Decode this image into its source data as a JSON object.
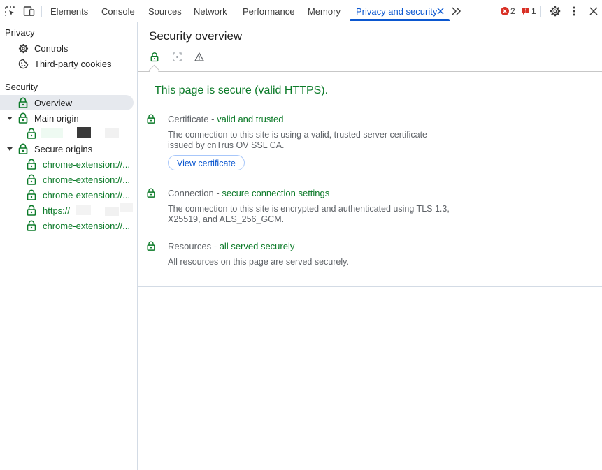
{
  "toolbar": {
    "tabs": [
      "Elements",
      "Console",
      "Sources",
      "Network",
      "Performance",
      "Memory",
      "Privacy and security"
    ],
    "active_tab": "Privacy and security",
    "error_count": "2",
    "issue_count": "1",
    "error_color": "#d93025",
    "issue_color": "#d93025",
    "accent_color": "#0b57d0",
    "icons": [
      "inspect-element-icon",
      "device-toolbar-icon",
      "close-tab-icon",
      "more-tabs-icon",
      "settings-gear-icon",
      "kebab-menu-icon",
      "close-devtools-icon"
    ]
  },
  "sidebar": {
    "privacy_heading": "Privacy",
    "privacy_items": [
      {
        "label": "Controls",
        "icon": "gear-icon"
      },
      {
        "label": "Third-party cookies",
        "icon": "cookie-icon"
      }
    ],
    "security_heading": "Security",
    "overview_label": "Overview",
    "main_origin_label": "Main origin",
    "secure_origins_label": "Secure origins",
    "secure_origin_items": [
      "chrome-extension://...",
      "chrome-extension://...",
      "chrome-extension://...",
      "https://",
      "chrome-extension://..."
    ],
    "secure_color": "#0b7a28"
  },
  "main": {
    "title": "Security overview",
    "summary": "This page is secure (valid HTTPS).",
    "certificate": {
      "label": "Certificate",
      "separator": " - ",
      "status": "valid and trusted",
      "description": "The connection to this site is using a valid, trusted server certificate issued by cnTrus OV SSL CA.",
      "button": "View certificate"
    },
    "connection": {
      "label": "Connection",
      "separator": " - ",
      "status": "secure connection settings",
      "description": "The connection to this site is encrypted and authenticated using TLS 1.3, X25519, and AES_256_GCM."
    },
    "resources": {
      "label": "Resources",
      "separator": " - ",
      "status": "all served securely",
      "description": "All resources on this page are served securely."
    }
  }
}
